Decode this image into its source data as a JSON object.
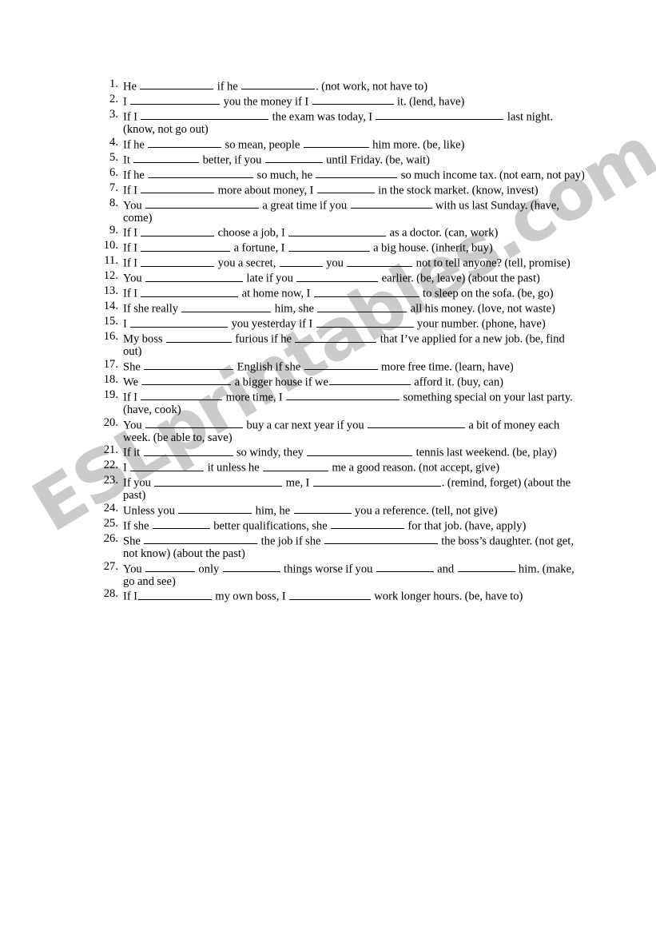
{
  "watermark": {
    "text": "ESLprintables.com",
    "color": "#c9c9c9"
  },
  "worksheet": {
    "items": [
      {
        "number": "1.",
        "text": "He __________ if he ___________. (not work, not have to)",
        "parts": [
          {
            "t": "text",
            "v": "He "
          },
          {
            "t": "blank",
            "w": "b9"
          },
          {
            "t": "text",
            "v": " if he "
          },
          {
            "t": "blank",
            "w": "b9"
          },
          {
            "t": "text",
            "v": ". (not work, not have to)"
          }
        ]
      },
      {
        "number": "2.",
        "text": "I ___________ you the money if I ___________ it. (lend, have)",
        "parts": [
          {
            "t": "text",
            "v": "I "
          },
          {
            "t": "blank",
            "w": "b11"
          },
          {
            "t": "text",
            "v": " you the money if I "
          },
          {
            "t": "blank",
            "w": "b10"
          },
          {
            "t": "text",
            "v": " it. (lend, have)"
          }
        ]
      },
      {
        "number": "3.",
        "text": "If I _________________ the exam was today, I ___________________ last night. (know, not go out)",
        "parts": [
          {
            "t": "text",
            "v": "If I "
          },
          {
            "t": "blank",
            "w": "b16"
          },
          {
            "t": "text",
            "v": " the exam was today, I "
          },
          {
            "t": "blank",
            "w": "b16"
          },
          {
            "t": "text",
            "v": " last night. (know, not go out)"
          }
        ]
      },
      {
        "number": "4.",
        "text": "If he __________ so mean, people _________ him more. (be, like)",
        "parts": [
          {
            "t": "text",
            "v": "If he "
          },
          {
            "t": "blank",
            "w": "b9"
          },
          {
            "t": "text",
            "v": " so mean, people "
          },
          {
            "t": "blank",
            "w": "b8"
          },
          {
            "t": "text",
            "v": " him more. (be, like)"
          }
        ]
      },
      {
        "number": "5.",
        "text": "It _________ better, if you _______ until Friday. (be, wait)",
        "parts": [
          {
            "t": "text",
            "v": "It "
          },
          {
            "t": "blank",
            "w": "b8"
          },
          {
            "t": "text",
            "v": " better, if you "
          },
          {
            "t": "blank",
            "w": "b7"
          },
          {
            "t": "text",
            "v": " until Friday. (be, wait)"
          }
        ]
      },
      {
        "number": "6.",
        "text": "If he ______________ so much, he __________ so much income tax. (not earn, not pay)",
        "parts": [
          {
            "t": "text",
            "v": "If he "
          },
          {
            "t": "blank",
            "w": "b13"
          },
          {
            "t": "text",
            "v": " so much, he "
          },
          {
            "t": "blank",
            "w": "b10"
          },
          {
            "t": "text",
            "v": " so much income tax. (not earn, not pay)"
          }
        ]
      },
      {
        "number": "7.",
        "text": "If I _________ more about money, I ________ in the stock market. (know, invest)",
        "parts": [
          {
            "t": "text",
            "v": "If I "
          },
          {
            "t": "blank",
            "w": "b9"
          },
          {
            "t": "text",
            "v": " more about money, I "
          },
          {
            "t": "blank",
            "w": "b7"
          },
          {
            "t": "text",
            "v": " in the stock market. (know, invest)"
          }
        ]
      },
      {
        "number": "8.",
        "text": "You ________________ a great time if you __________ with us last Sunday. (have, come)",
        "parts": [
          {
            "t": "text",
            "v": "You "
          },
          {
            "t": "blank",
            "w": "b14"
          },
          {
            "t": "text",
            "v": " a great time if you "
          },
          {
            "t": "blank",
            "w": "b10"
          },
          {
            "t": "text",
            "v": " with us last Sunday. (have, come)"
          }
        ]
      },
      {
        "number": "9.",
        "text": "If I __________ choose a job, I ____________ as a doctor. (can, work)",
        "parts": [
          {
            "t": "text",
            "v": "If I "
          },
          {
            "t": "blank",
            "w": "b9"
          },
          {
            "t": "text",
            "v": " choose a job, I "
          },
          {
            "t": "blank",
            "w": "b12"
          },
          {
            "t": "text",
            "v": " as a doctor. (can, work)"
          }
        ]
      },
      {
        "number": "10.",
        "text": "If I ___________ a fortune, I __________ a big house. (inherit, buy)",
        "parts": [
          {
            "t": "text",
            "v": "If I "
          },
          {
            "t": "blank",
            "w": "b11"
          },
          {
            "t": "text",
            "v": " a fortune, I "
          },
          {
            "t": "blank",
            "w": "b10"
          },
          {
            "t": "text",
            "v": " a big house. (inherit, buy)"
          }
        ]
      },
      {
        "number": "11.",
        "text": "If I _________ you a secret, ______ you _________ not to tell anyone? (tell, promise)",
        "parts": [
          {
            "t": "text",
            "v": "If I "
          },
          {
            "t": "blank",
            "w": "b9"
          },
          {
            "t": "text",
            "v": " you a secret, "
          },
          {
            "t": "blank",
            "w": "b5"
          },
          {
            "t": "text",
            "v": " you "
          },
          {
            "t": "blank",
            "w": "b8"
          },
          {
            "t": "text",
            "v": " not to tell anyone? (tell, promise)"
          }
        ]
      },
      {
        "number": "12.",
        "text": "You ______________ late if you __________ earlier. (be, leave) (about the past)",
        "parts": [
          {
            "t": "text",
            "v": "You "
          },
          {
            "t": "blank",
            "w": "b12"
          },
          {
            "t": "text",
            "v": " late if you "
          },
          {
            "t": "blank",
            "w": "b10"
          },
          {
            "t": "text",
            "v": " earlier. (be, leave) (about the past)"
          }
        ]
      },
      {
        "number": "13.",
        "text": "If I _____________ at home now, I ______________ to sleep on the sofa. (be, go)",
        "parts": [
          {
            "t": "text",
            "v": "If I "
          },
          {
            "t": "blank",
            "w": "b12"
          },
          {
            "t": "text",
            "v": " at home now, I "
          },
          {
            "t": "blank",
            "w": "b13"
          },
          {
            "t": "text",
            "v": " to sleep on the sofa. (be, go)"
          }
        ]
      },
      {
        "number": "14.",
        "text": "If she really ____________ him, she ____________ all his money. (love, not waste)",
        "parts": [
          {
            "t": "text",
            "v": "If she really "
          },
          {
            "t": "blank",
            "w": "b11"
          },
          {
            "t": "text",
            "v": " him, she "
          },
          {
            "t": "blank",
            "w": "b11"
          },
          {
            "t": "text",
            "v": " all his money. (love, not waste)"
          }
        ]
      },
      {
        "number": "15.",
        "text": "I _____________ you yesterday if I ______________ your number. (phone, have)",
        "parts": [
          {
            "t": "text",
            "v": "I "
          },
          {
            "t": "blank",
            "w": "b12"
          },
          {
            "t": "text",
            "v": " you yesterday if I "
          },
          {
            "t": "blank",
            "w": "b12"
          },
          {
            "t": "text",
            "v": " your number. (phone, have)"
          }
        ]
      },
      {
        "number": "16.",
        "text": "My boss _________ furious if he ___________ that I've applied for a new job. (be, find out)",
        "parts": [
          {
            "t": "text",
            "v": "My boss "
          },
          {
            "t": "blank",
            "w": "b8"
          },
          {
            "t": "text",
            "v": " furious if he "
          },
          {
            "t": "blank",
            "w": "b10"
          },
          {
            "t": "text",
            "v": " that I’ve applied for a new job. (be, find out)"
          }
        ]
      },
      {
        "number": "17.",
        "text": "She _____________ English if she __________ more free time. (learn, have)",
        "parts": [
          {
            "t": "text",
            "v": "She "
          },
          {
            "t": "blank",
            "w": "b11"
          },
          {
            "t": "text",
            "v": " English if she "
          },
          {
            "t": "blank",
            "w": "b9"
          },
          {
            "t": "text",
            "v": " more free time. (learn, have)"
          }
        ]
      },
      {
        "number": "18.",
        "text": "We _____________ a bigger house if we_________ afford it. (buy, can)",
        "parts": [
          {
            "t": "text",
            "v": "We "
          },
          {
            "t": "blank",
            "w": "b11"
          },
          {
            "t": "text",
            "v": " a bigger house if we"
          },
          {
            "t": "blank",
            "w": "b10"
          },
          {
            "t": "text",
            "v": " afford it. (buy, can)"
          }
        ]
      },
      {
        "number": "19.",
        "text": "If I ___________ more time, I ________________ something special on your last party. (have, cook)",
        "parts": [
          {
            "t": "text",
            "v": "If I "
          },
          {
            "t": "blank",
            "w": "b10"
          },
          {
            "t": "text",
            "v": " more time, I "
          },
          {
            "t": "blank",
            "w": "b14"
          },
          {
            "t": "text",
            "v": " something special on your last party. (have, cook)"
          }
        ]
      },
      {
        "number": "20.",
        "text": "You ____________ buy a car next year if you ____________ a bit of money each week. (be able to, save)",
        "parts": [
          {
            "t": "text",
            "v": "You "
          },
          {
            "t": "blank",
            "w": "b12"
          },
          {
            "t": "text",
            "v": " buy a car next year if you "
          },
          {
            "t": "blank",
            "w": "b12"
          },
          {
            "t": "text",
            "v": " a bit of money each week. (be able to, save)"
          }
        ]
      },
      {
        "number": "21.",
        "text": "If it ____________ so windy, they _____________ tennis last weekend. (be, play)",
        "parts": [
          {
            "t": "text",
            "v": "If it "
          },
          {
            "t": "blank",
            "w": "b11"
          },
          {
            "t": "text",
            "v": " so windy, they "
          },
          {
            "t": "blank",
            "w": "b13"
          },
          {
            "t": "text",
            "v": " tennis last weekend. (be, play)"
          }
        ]
      },
      {
        "number": "22.",
        "text": "I __________ it unless he ________ me a good reason. (not accept, give)",
        "parts": [
          {
            "t": "text",
            "v": "I "
          },
          {
            "t": "blank",
            "w": "b9"
          },
          {
            "t": "text",
            "v": " it unless he "
          },
          {
            "t": "blank",
            "w": "b8"
          },
          {
            "t": "text",
            "v": " me a good reason. (not accept, give)"
          }
        ]
      },
      {
        "number": "23.",
        "text": "If you _________________ me, I _____________________. (remind, forget) (about the past)",
        "parts": [
          {
            "t": "text",
            "v": "If you "
          },
          {
            "t": "blank",
            "w": "b16"
          },
          {
            "t": "text",
            "v": " me, I "
          },
          {
            "t": "blank",
            "w": "b16"
          },
          {
            "t": "text",
            "v": ". (remind, forget) (about the past)"
          }
        ]
      },
      {
        "number": "24.",
        "text": "Unless you _________ him, he _______ you a reference. (tell, not give)",
        "parts": [
          {
            "t": "text",
            "v": "Unless you "
          },
          {
            "t": "blank",
            "w": "b9"
          },
          {
            "t": "text",
            "v": " him, he "
          },
          {
            "t": "blank",
            "w": "b7"
          },
          {
            "t": "text",
            "v": " you a reference. (tell, not give)"
          }
        ]
      },
      {
        "number": "25.",
        "text": "If she ________ better qualifications, she __________ for that job. (have, apply)",
        "parts": [
          {
            "t": "text",
            "v": "If she "
          },
          {
            "t": "blank",
            "w": "b7"
          },
          {
            "t": "text",
            "v": " better qualifications, she "
          },
          {
            "t": "blank",
            "w": "b9"
          },
          {
            "t": "text",
            "v": " for that job. (have, apply)"
          }
        ]
      },
      {
        "number": "26.",
        "text": "She ________________ the job if she ___________________ the boss's daughter. (not get, not know) (about the past)",
        "parts": [
          {
            "t": "text",
            "v": "She "
          },
          {
            "t": "blank",
            "w": "b14"
          },
          {
            "t": "text",
            "v": " the job if she "
          },
          {
            "t": "blank",
            "w": "b14"
          },
          {
            "t": "text",
            "v": " the boss’s daughter. (not get, not know) (about the past)"
          }
        ]
      },
      {
        "number": "27.",
        "text": "You ______ only ________ things worse if you _______ and _______ him. (make, go and see)",
        "parts": [
          {
            "t": "text",
            "v": "You "
          },
          {
            "t": "blank",
            "w": "b6"
          },
          {
            "t": "text",
            "v": " only "
          },
          {
            "t": "blank",
            "w": "b7"
          },
          {
            "t": "text",
            "v": " things worse if you "
          },
          {
            "t": "blank",
            "w": "b7"
          },
          {
            "t": "text",
            "v": " and "
          },
          {
            "t": "blank",
            "w": "b7"
          },
          {
            "t": "text",
            "v": " him. (make, go and see)"
          }
        ]
      },
      {
        "number": "28.",
        "text": "If I_________ my own boss, I __________ work longer hours. (be, have to)",
        "parts": [
          {
            "t": "text",
            "v": "If I"
          },
          {
            "t": "blank",
            "w": "b9"
          },
          {
            "t": "text",
            "v": " my own boss, I "
          },
          {
            "t": "blank",
            "w": "b10"
          },
          {
            "t": "text",
            "v": " work longer hours. (be, have to)"
          }
        ]
      }
    ]
  }
}
